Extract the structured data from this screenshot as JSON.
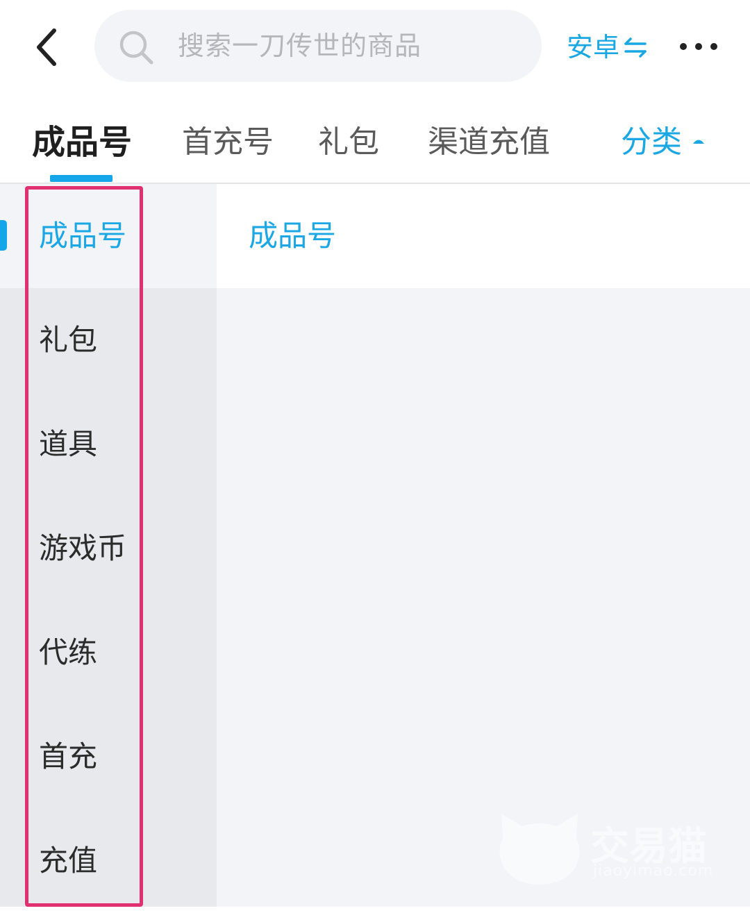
{
  "header": {
    "search_placeholder": "搜索一刀传世的商品",
    "platform_label": "安卓"
  },
  "tabs": [
    {
      "label": "成品号",
      "active": true
    },
    {
      "label": "首充号"
    },
    {
      "label": "礼包"
    },
    {
      "label": "渠道充值"
    },
    {
      "label": "分类"
    }
  ],
  "sidebar": {
    "items": [
      {
        "label": "成品号",
        "active": true
      },
      {
        "label": "礼包"
      },
      {
        "label": "道具"
      },
      {
        "label": "游戏币"
      },
      {
        "label": "代练"
      },
      {
        "label": "首充"
      },
      {
        "label": "充值"
      }
    ]
  },
  "content": {
    "title": "成品号"
  },
  "watermark": {
    "text_cn": "交易猫",
    "text_en": "jiaoyimao.com"
  },
  "colors": {
    "accent": "#1aa7e3",
    "highlight_border": "#e0306f",
    "sidebar_bg": "#e8e9ed",
    "content_bg": "#f3f4f7"
  },
  "icons": [
    "back-arrow-icon",
    "search-icon",
    "swap-arrows-icon",
    "more-icon",
    "caret-up-icon"
  ]
}
